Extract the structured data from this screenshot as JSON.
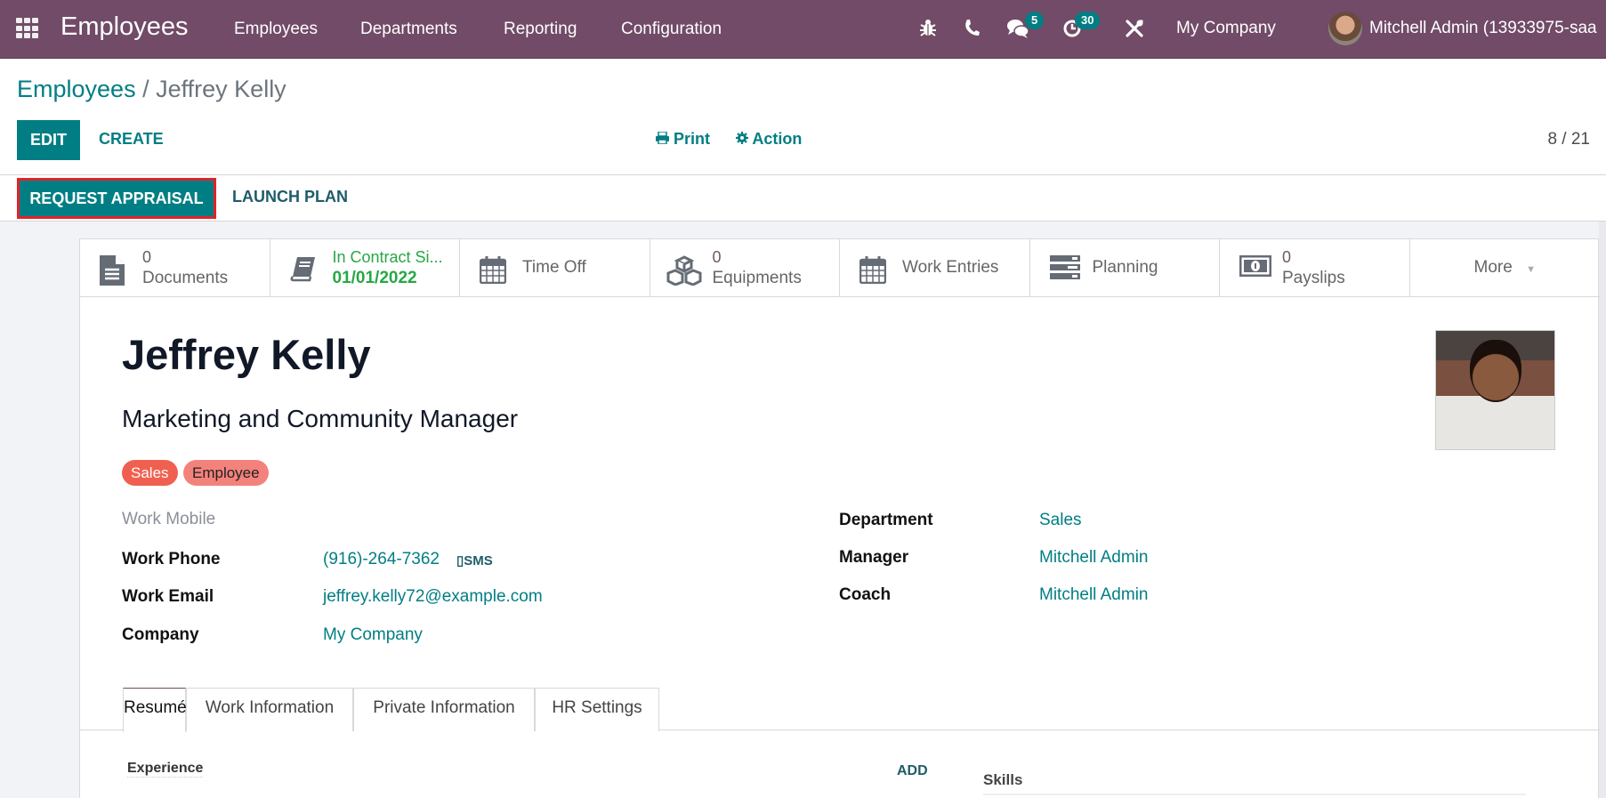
{
  "navbar": {
    "app_title": "Employees",
    "menu": [
      "Employees",
      "Departments",
      "Reporting",
      "Configuration"
    ],
    "messages_count": "5",
    "activities_count": "30",
    "company": "My Company",
    "user": "Mitchell Admin (13933975-saa",
    "icons": [
      "apps-grid-icon",
      "bug-icon",
      "phone-icon",
      "chat-icon",
      "clock-icon",
      "tools-icon"
    ]
  },
  "breadcrumb": {
    "parent": "Employees",
    "separator": "/",
    "current": "Jeffrey Kelly"
  },
  "toolbar": {
    "edit": "EDIT",
    "create": "CREATE",
    "print": "Print",
    "action": "Action",
    "pager": "8 / 21"
  },
  "statusbar": {
    "request_appraisal": "REQUEST APPRAISAL",
    "launch_plan": "LAUNCH PLAN"
  },
  "stats": [
    {
      "icon": "document-icon",
      "value": "0",
      "label": "Documents"
    },
    {
      "icon": "book-icon",
      "value": "In Contract Si...",
      "label": "01/01/2022"
    },
    {
      "icon": "calendar-icon",
      "label": "Time Off"
    },
    {
      "icon": "cubes-icon",
      "value": "0",
      "label": "Equipments"
    },
    {
      "icon": "calendar-icon",
      "label": "Work Entries"
    },
    {
      "icon": "tasks-icon",
      "label": "Planning"
    },
    {
      "icon": "money-icon",
      "value": "0",
      "label": "Payslips"
    },
    {
      "label": "More"
    }
  ],
  "employee": {
    "name": "Jeffrey Kelly",
    "job_title": "Marketing and Community Manager",
    "tags": [
      {
        "label": "Sales",
        "color": "#f06050"
      },
      {
        "label": "Employee",
        "color": "#f4827c"
      }
    ]
  },
  "fields_left": [
    {
      "label": "Work Mobile",
      "value": ""
    },
    {
      "label": "Work Phone",
      "value": "(916)-264-7362",
      "action": "SMS"
    },
    {
      "label": "Work Email",
      "value": "jeffrey.kelly72@example.com"
    },
    {
      "label": "Company",
      "value": "My Company"
    }
  ],
  "fields_right": [
    {
      "label": "Department",
      "value": "Sales"
    },
    {
      "label": "Manager",
      "value": "Mitchell Admin"
    },
    {
      "label": "Coach",
      "value": "Mitchell Admin"
    }
  ],
  "tabs": [
    "Resumé",
    "Work Information",
    "Private Information",
    "HR Settings"
  ],
  "resume": {
    "experience": "Experience",
    "add": "ADD",
    "skills": "Skills"
  },
  "colors": {
    "brand": "#714B67",
    "primary": "#017e84",
    "highlight": "#e02328"
  }
}
